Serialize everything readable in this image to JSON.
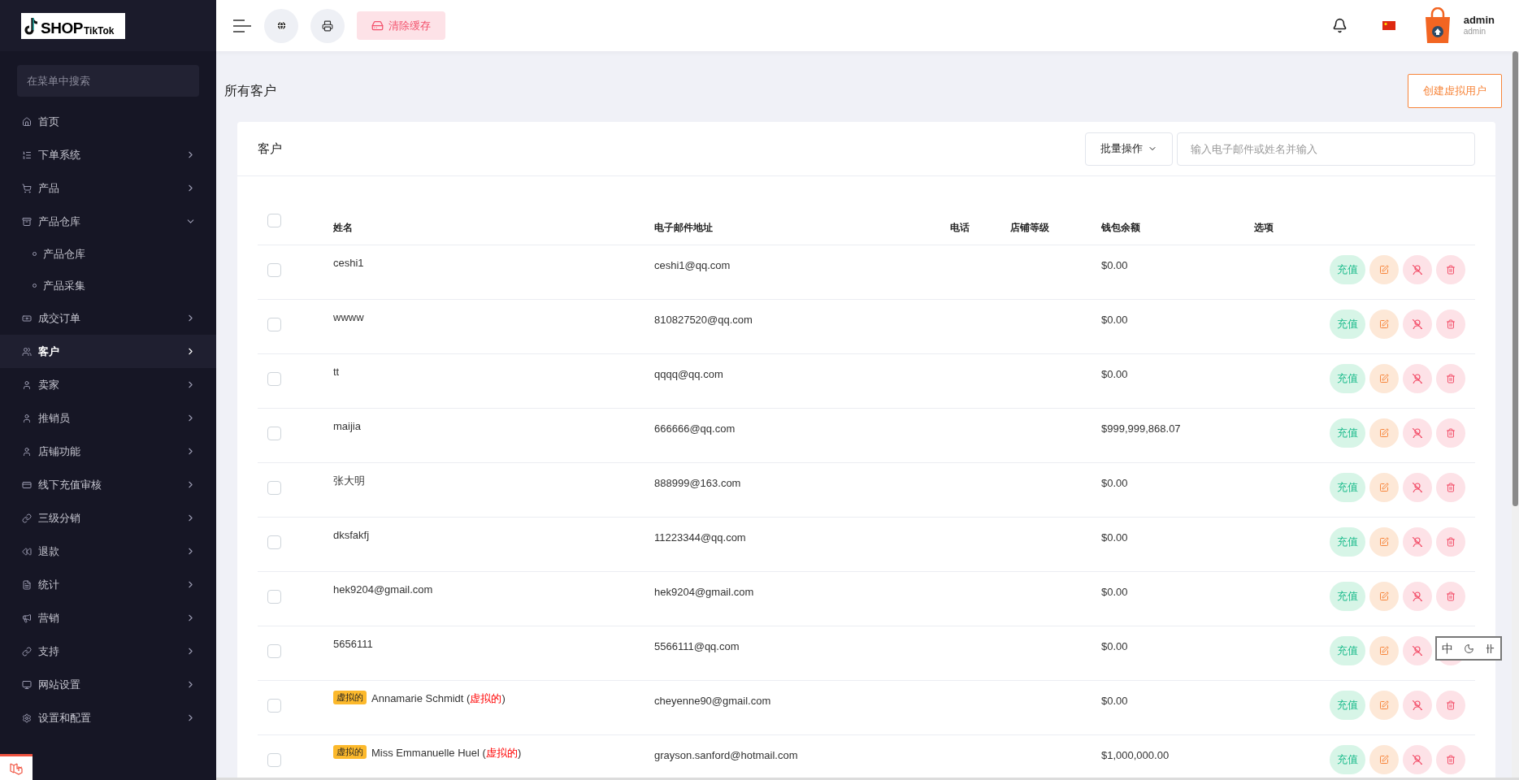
{
  "logo": {
    "text": "SHOP",
    "subtext": "TikTok"
  },
  "sidebar": {
    "search_placeholder": "在菜单中搜索",
    "items": [
      {
        "label": "首页",
        "kind": "link",
        "selected": false
      },
      {
        "label": "下单系统",
        "kind": "group",
        "selected": false,
        "expanded": false
      },
      {
        "label": "产品",
        "kind": "group",
        "selected": false,
        "expanded": false
      },
      {
        "label": "产品仓库",
        "kind": "group",
        "selected": false,
        "expanded": true,
        "children": [
          {
            "label": "产品仓库"
          },
          {
            "label": "产品采集"
          }
        ]
      },
      {
        "label": "成交订单",
        "kind": "group",
        "selected": false,
        "expanded": false
      },
      {
        "label": "客户",
        "kind": "group",
        "selected": true,
        "expanded": false
      },
      {
        "label": "卖家",
        "kind": "group",
        "selected": false,
        "expanded": false
      },
      {
        "label": "推销员",
        "kind": "group",
        "selected": false,
        "expanded": false
      },
      {
        "label": "店铺功能",
        "kind": "group",
        "selected": false,
        "expanded": false
      },
      {
        "label": "线下充值审核",
        "kind": "group",
        "selected": false,
        "expanded": false
      },
      {
        "label": "三级分销",
        "kind": "group",
        "selected": false,
        "expanded": false
      },
      {
        "label": "退款",
        "kind": "group",
        "selected": false,
        "expanded": false
      },
      {
        "label": "统计",
        "kind": "group",
        "selected": false,
        "expanded": false
      },
      {
        "label": "营销",
        "kind": "group",
        "selected": false,
        "expanded": false
      },
      {
        "label": "支持",
        "kind": "group",
        "selected": false,
        "expanded": false
      },
      {
        "label": "网站设置",
        "kind": "group",
        "selected": false,
        "expanded": false
      },
      {
        "label": "设置和配置",
        "kind": "group",
        "selected": false,
        "expanded": false
      }
    ]
  },
  "header": {
    "clear_cache": "清除缓存",
    "user": {
      "name": "admin",
      "role": "admin"
    }
  },
  "page": {
    "title": "所有客户",
    "create_button": "创建虚拟用户"
  },
  "card": {
    "title": "客户",
    "bulk_button": "批量操作",
    "search_placeholder": "输入电子邮件或姓名并输入",
    "table": {
      "select_all_checked": false,
      "columns": [
        "姓名",
        "电子邮件地址",
        "电话",
        "店铺等级",
        "钱包余额",
        "选项"
      ],
      "rows": [
        {
          "checked": false,
          "virtual_badge": null,
          "name_parts": [
            {
              "text": "ceshi1",
              "kind": "plain"
            }
          ],
          "email": "ceshi1@qq.com",
          "balance": "$0.00",
          "recharge": "充值"
        },
        {
          "checked": false,
          "virtual_badge": null,
          "name_parts": [
            {
              "text": "wwww",
              "kind": "plain"
            }
          ],
          "email": "810827520@qq.com",
          "balance": "$0.00",
          "recharge": "充值"
        },
        {
          "checked": false,
          "virtual_badge": null,
          "name_parts": [
            {
              "text": "tt",
              "kind": "plain"
            }
          ],
          "email": "qqqq@qq.com",
          "balance": "$0.00",
          "recharge": "充值"
        },
        {
          "checked": false,
          "virtual_badge": null,
          "name_parts": [
            {
              "text": "maijia",
              "kind": "plain"
            }
          ],
          "email": "666666@qq.com",
          "balance": "$999,999,868.07",
          "recharge": "充值"
        },
        {
          "checked": false,
          "virtual_badge": null,
          "name_parts": [
            {
              "text": "张大明",
              "kind": "plain"
            }
          ],
          "email": "888999@163.com",
          "balance": "$0.00",
          "recharge": "充值"
        },
        {
          "checked": false,
          "virtual_badge": null,
          "name_parts": [
            {
              "text": "dksfakfj",
              "kind": "plain"
            }
          ],
          "email": "11223344@qq.com",
          "balance": "$0.00",
          "recharge": "充值"
        },
        {
          "checked": false,
          "virtual_badge": null,
          "name_parts": [
            {
              "text": "hek9204@gmail.com",
              "kind": "plain"
            }
          ],
          "email": "hek9204@gmail.com",
          "balance": "$0.00",
          "recharge": "充值"
        },
        {
          "checked": false,
          "virtual_badge": null,
          "name_parts": [
            {
              "text": "5656111",
              "kind": "plain"
            }
          ],
          "email": "5566111@qq.com",
          "balance": "$0.00",
          "recharge": "充值"
        },
        {
          "checked": false,
          "virtual_badge": "虚拟的",
          "name_parts": [
            {
              "text": "Annamarie Schmidt (",
              "kind": "plain"
            },
            {
              "text": "虚拟的",
              "kind": "flag"
            },
            {
              "text": ")",
              "kind": "plain"
            }
          ],
          "email": "cheyenne90@gmail.com",
          "balance": "$0.00",
          "recharge": "充值"
        },
        {
          "checked": false,
          "virtual_badge": "虚拟的",
          "name_parts": [
            {
              "text": "Miss Emmanuelle Huel (",
              "kind": "plain"
            },
            {
              "text": "虚拟的",
              "kind": "flag"
            },
            {
              "text": ")",
              "kind": "plain"
            }
          ],
          "email": "grayson.sanford@hotmail.com",
          "balance": "$1,000,000.00",
          "recharge": "充值"
        }
      ]
    }
  },
  "ime_toolbar": {
    "mode": "中"
  }
}
